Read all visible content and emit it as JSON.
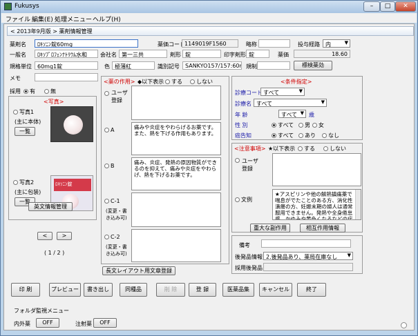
{
  "window": {
    "title": "Fukusys",
    "min": "–",
    "max": "□",
    "close": "✕"
  },
  "menu": [
    "ファイル",
    "編集(E)",
    "処理メニュー",
    "ヘルプ(H)"
  ],
  "header": {
    "title": "< 2013年9月版 > 薬剤情報管理"
  },
  "top": {
    "drug_name_label": "薬剤名",
    "drug_name": "ﾛｷｿﾆﾝ錠60mg",
    "price_code_label": "薬価コード",
    "price_code": "1149019F1560",
    "abbrev_label": "略称",
    "route_label": "投与経路",
    "route": "内",
    "generic_label": "一般名",
    "generic": "ﾛｷｿﾌﾟﾛﾌｪﾝﾅﾄﾘｳﾑ水和",
    "company_label": "会社名",
    "company": "第一三共",
    "form_label": "剤形",
    "form": "錠",
    "stamp_form_label": "印字剤形",
    "stamp_form": "錠",
    "price_label": "薬価",
    "price": "18.60",
    "unit_label": "規格単位",
    "unit": "60mg1錠",
    "color_label": "色",
    "color": "極薄紅",
    "id_label": "識別記号",
    "id": "SANKYO157/157:60mg",
    "reg_label": "規制",
    "label_btn": "標検薬効",
    "memo_label": "メモ",
    "adopt_label": "採用",
    "adopt_yes": "有",
    "adopt_no": "無"
  },
  "photo": {
    "header": "<写真>",
    "p1": "写真1",
    "p1_sub": "(主に本体)",
    "p2": "写真2",
    "p2_sub": "(主に包装)",
    "list_btn": "一覧",
    "pill_text": "ﾛｷｿﾆﾝ錠",
    "eng_btn": "英文情報管理",
    "page": "( 1 / 2 )",
    "prev": "<",
    "next": ">"
  },
  "action": {
    "header": "<薬の作用>",
    "show": "◆以下表示",
    "do": "する",
    "dont": "しない",
    "user": "ユーザ登録",
    "a": "A",
    "b": "B",
    "c1": "C-1",
    "c2": "C-2",
    "mod": "(変更・書き込み可)",
    "a_text": "痛みや炎症をやわらげるお薬です。また、熱を下げる作用もあります。",
    "b_text": "痛み、炎症、発熱の原因物質ができるのを抑えて、痛みや炎症をやわらげ、熱を下げるお薬です。",
    "layout_btn": "長文レイアウト用文章登録"
  },
  "cond": {
    "header": "<条件指定>",
    "code_label": "診療コード",
    "code": "すべて",
    "dept_label": "診療名",
    "dept": "すべて",
    "age_label": "年 齢",
    "age": "すべて",
    "age_unit": "歳",
    "sex_label": "性 別",
    "all": "すべて",
    "male": "男",
    "female": "女",
    "preg_label": "癌告知",
    "yes": "あり",
    "no": "なし"
  },
  "caution": {
    "header": "<注意事項>",
    "show": "★以下表示",
    "do": "する",
    "dont": "しない",
    "user": "ユーザ登録",
    "example": "文例",
    "text": "★アスピリンや他の解熱鎮痛薬で喘息がでたことのある方、消化性潰瘍の方、妊娠末期の婦人は通常服用できません。発熱や全身倦怠感、かゆみや黄色くなるなどの症",
    "side_btn": "重大な副作用",
    "inter_btn": "相互作用情報"
  },
  "remarks": {
    "label": "備考",
    "generic_info_label": "後発品情報",
    "generic_info": "2.後発品あり、薬局在庫なし",
    "adopt_generic_label": "採用後発品"
  },
  "buttons": [
    "印 刷",
    "プレビュー",
    "書き出し",
    "同種品",
    "削 除",
    "登 録",
    "医薬品集",
    "キャンセル",
    "終了"
  ],
  "folder": {
    "title": "フォルダ監視メニュー",
    "internal": "内外薬",
    "internal_val": "OFF",
    "injection": "注射薬",
    "injection_val": "OFF"
  }
}
